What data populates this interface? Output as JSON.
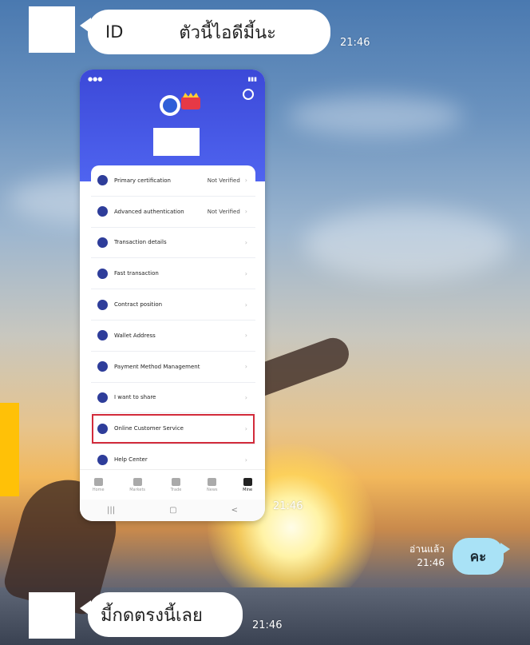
{
  "chat": {
    "msg1": {
      "text_id": "ID",
      "text_thai": "ตัวนี้ไอดีมี้นะ",
      "time": "21:46"
    },
    "screenshot_time": "21:46",
    "reply": {
      "read_label": "อ่านแล้ว",
      "time": "21:46",
      "text": "คะ"
    },
    "msg2": {
      "text": "มี้กดตรงนี้เลย",
      "time": "21:46"
    }
  },
  "phone": {
    "menu_items": [
      {
        "label": "Primary certification",
        "value": "Not Verified"
      },
      {
        "label": "Advanced authentication",
        "value": "Not Verified"
      },
      {
        "label": "Transaction details",
        "value": ""
      },
      {
        "label": "Fast transaction",
        "value": ""
      },
      {
        "label": "Contract position",
        "value": ""
      },
      {
        "label": "Wallet Address",
        "value": ""
      },
      {
        "label": "Payment Method Management",
        "value": ""
      },
      {
        "label": "I want to share",
        "value": ""
      },
      {
        "label": "Online Customer Service",
        "value": ""
      },
      {
        "label": "Help Center",
        "value": ""
      }
    ],
    "highlighted_item": "Online Customer Service",
    "tabs": [
      {
        "label": "Home",
        "icon": "home-icon"
      },
      {
        "label": "Markets",
        "icon": "markets-icon"
      },
      {
        "label": "Trade",
        "icon": "trade-icon"
      },
      {
        "label": "News",
        "icon": "news-icon"
      },
      {
        "label": "Mine",
        "icon": "user-icon"
      }
    ],
    "system_nav": [
      "|||",
      "▢",
      "<"
    ]
  },
  "colors": {
    "phone_header": "#3c49d8",
    "highlight": "#d22b3b",
    "my_bubble": "#a9e2f6",
    "accent_bar": "#ffc107"
  }
}
